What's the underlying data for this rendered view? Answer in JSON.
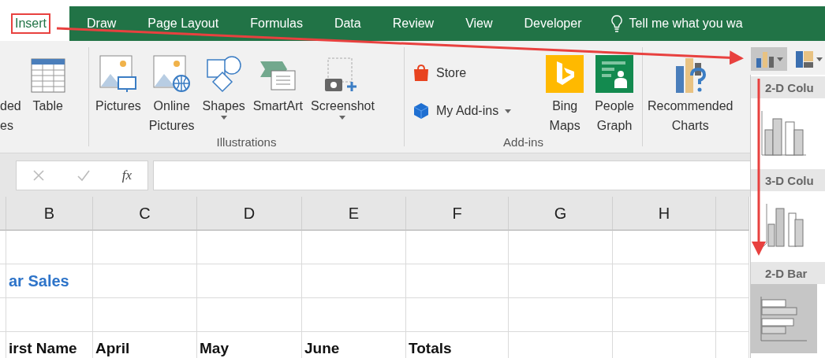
{
  "tabs": [
    {
      "label": "Insert",
      "selected": true,
      "outlined": true
    },
    {
      "label": "Draw",
      "selected": false,
      "outlined": false
    },
    {
      "label": "Page Layout",
      "selected": false,
      "outlined": false
    },
    {
      "label": "Formulas",
      "selected": false,
      "outlined": false
    },
    {
      "label": "Data",
      "selected": false,
      "outlined": false
    },
    {
      "label": "Review",
      "selected": false,
      "outlined": false
    },
    {
      "label": "View",
      "selected": false,
      "outlined": false
    },
    {
      "label": "Developer",
      "selected": false,
      "outlined": false
    }
  ],
  "tell_me": {
    "placeholder": "Tell me what you wa"
  },
  "ribbon": {
    "groups": [
      {
        "buttons": [
          {
            "kind": "partial",
            "lines": [
              "ded",
              "es"
            ],
            "dropdown": false
          },
          {
            "kind": "table",
            "lines": [
              "Table"
            ],
            "dropdown": false
          }
        ]
      },
      {
        "label": "Illustrations",
        "buttons": [
          {
            "kind": "pictures",
            "lines": [
              "Pictures"
            ],
            "dropdown": false
          },
          {
            "kind": "online",
            "lines": [
              "Online",
              "Pictures"
            ],
            "dropdown": false
          },
          {
            "kind": "shapes",
            "lines": [
              "Shapes"
            ],
            "dropdown": true
          },
          {
            "kind": "smartart",
            "lines": [
              "SmartArt"
            ],
            "dropdown": false
          },
          {
            "kind": "screenshot",
            "lines": [
              "Screenshot"
            ],
            "dropdown": true
          }
        ]
      },
      {
        "label": "Add-ins",
        "buttons": [
          {
            "kind": "store",
            "lines": [
              "Store"
            ],
            "dropdown": false
          },
          {
            "kind": "addins",
            "lines": [
              "My Add-ins"
            ],
            "dropdown": true
          },
          {
            "kind": "bing",
            "lines": [
              "Bing",
              "Maps"
            ],
            "dropdown": false
          },
          {
            "kind": "people",
            "lines": [
              "People",
              "Graph"
            ],
            "dropdown": false
          }
        ]
      },
      {
        "buttons": [
          {
            "kind": "recommended",
            "lines": [
              "Recommended",
              "Charts"
            ],
            "dropdown": false
          }
        ]
      }
    ]
  },
  "chart_buttons": [
    {
      "kind": "column",
      "selected": true
    },
    {
      "kind": "hierarchy",
      "selected": false
    }
  ],
  "chart_menu": [
    {
      "title": "2-D Colu",
      "kind": "column2d",
      "selected": false
    },
    {
      "title": "3-D Colu",
      "kind": "column3d",
      "selected": false
    },
    {
      "title": "2-D Bar",
      "kind": "bar2d",
      "selected": true
    }
  ],
  "formula_bar": {
    "function_label": "fx"
  },
  "sheet": {
    "columns": [
      "B",
      "C",
      "D",
      "E",
      "F",
      "G",
      "H"
    ],
    "rows": [
      {
        "kind": "blank"
      },
      {
        "kind": "title",
        "cells": [
          "ar Sales",
          null,
          null,
          null,
          null,
          null,
          null
        ]
      },
      {
        "kind": "blank"
      },
      {
        "kind": "header",
        "cells": [
          "irst Name",
          "April",
          "May",
          "June",
          "Totals",
          null,
          null
        ]
      }
    ]
  }
}
